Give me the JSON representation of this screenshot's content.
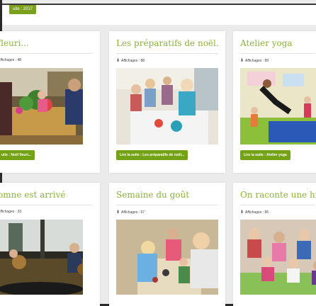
{
  "top_button": "uite : 2017",
  "views_label": "Affichages :",
  "cards": [
    {
      "title": "fleuri...",
      "views": "48",
      "button": "uite : Noël fleuri..."
    },
    {
      "title": "Les préparatifs de noël...",
      "views": "88",
      "button": "Lire la suite : Les préparatifs de noël..."
    },
    {
      "title": "Atelier yoga",
      "views": "89",
      "button": "Lire la suite : Atelier yoga"
    },
    {
      "title": "omne est arrivé",
      "views": "33",
      "button": ""
    },
    {
      "title": "Semaine du goût",
      "views": "67",
      "button": ""
    },
    {
      "title": "On raconte une histo",
      "views": "86",
      "button": ""
    }
  ],
  "colors": {
    "accent": "#8cb23a",
    "button": "#73a214"
  },
  "icons": {
    "views": "download-icon"
  }
}
